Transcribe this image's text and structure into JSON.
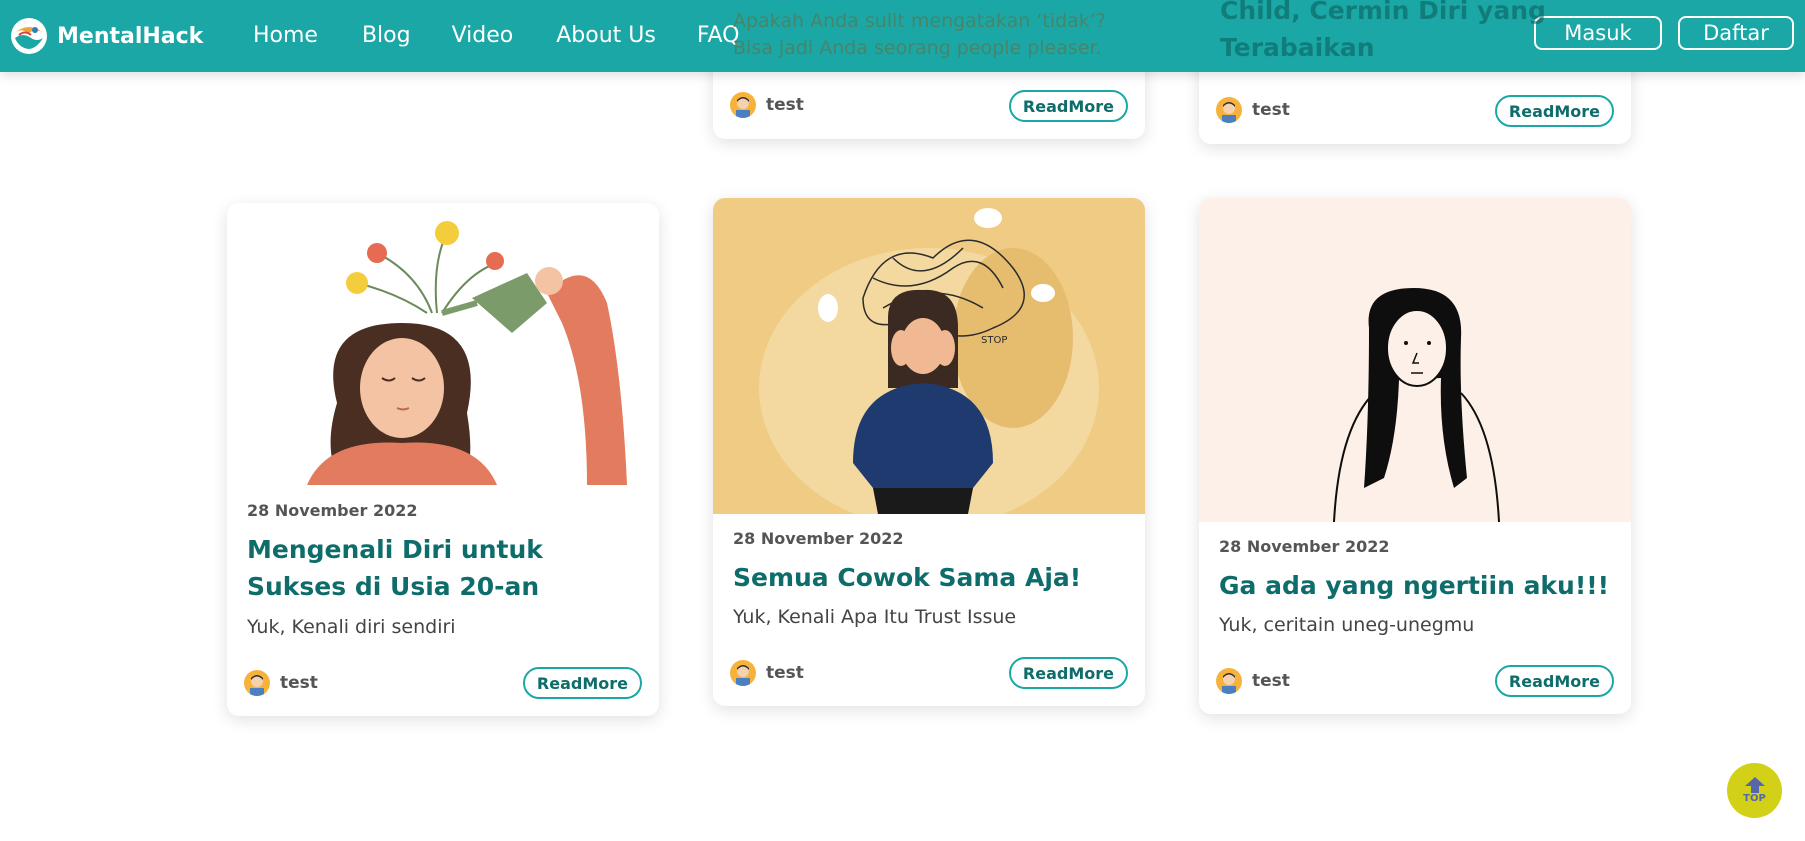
{
  "brand": {
    "name": "MentalHack"
  },
  "nav": {
    "links": [
      "Home",
      "Blog",
      "Video",
      "About Us",
      "FAQ"
    ],
    "login": "Masuk",
    "register": "Daftar"
  },
  "partial_cards": [
    {
      "excerpt_line1": "Apakah Anda sulit mengatakan ‘tidak’?",
      "excerpt_line2": "Bisa jadi Anda seorang people pleaser.",
      "author": "test",
      "readmore": "ReadMore"
    },
    {
      "title_line1": "Child, Cermin Diri yang",
      "title_line2": "Terabaikan",
      "author": "test",
      "readmore": "ReadMore"
    }
  ],
  "cards": [
    {
      "date": "28 November 2022",
      "title": "Mengenali Diri untuk Sukses di Usia 20-an",
      "excerpt": "Yuk, Kenali diri sendiri",
      "author": "test",
      "readmore": "ReadMore"
    },
    {
      "date": "28 November 2022",
      "title": "Semua Cowok Sama Aja!",
      "excerpt": "Yuk, Kenali Apa Itu Trust Issue",
      "author": "test",
      "readmore": "ReadMore"
    },
    {
      "date": "28 November 2022",
      "title": "Ga ada yang ngertiin aku!!!",
      "excerpt": "Yuk, ceritain uneg-unegmu",
      "author": "test",
      "readmore": "ReadMore"
    }
  ],
  "top_button": {
    "label": "TOP"
  },
  "colors": {
    "primary": "#1ba7a5",
    "title": "#0e6d6b",
    "top_button": "#d3d018"
  }
}
